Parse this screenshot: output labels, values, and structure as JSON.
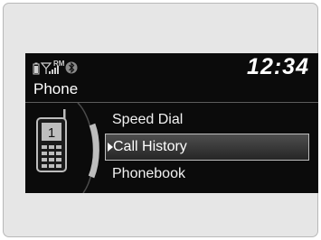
{
  "status": {
    "carrier": "RM",
    "time": "12:34"
  },
  "screen_title": "Phone",
  "phone_icon_number": "1",
  "menu": {
    "items": [
      {
        "label": "Speed Dial",
        "selected": false
      },
      {
        "label": "Call History",
        "selected": true
      },
      {
        "label": "Phonebook",
        "selected": false
      }
    ]
  }
}
